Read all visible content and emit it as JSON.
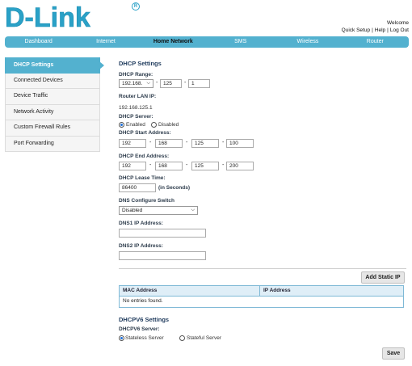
{
  "brand": {
    "logo_text": "D-Link",
    "reg_mark": "R"
  },
  "header": {
    "welcome": "Welcome",
    "links": [
      "Quick Setup",
      "Help",
      "Log Out"
    ],
    "separator": "|"
  },
  "nav": {
    "items": [
      "Dashboard",
      "Internet",
      "Home Network",
      "SMS",
      "Wireless",
      "Router"
    ],
    "active": "Home Network"
  },
  "sidebar": {
    "items": [
      "DHCP Settings",
      "Connected Devices",
      "Device Traffic",
      "Network Activity",
      "Custom Firewall Rules",
      "Port Forwarding"
    ],
    "active": "DHCP Settings"
  },
  "dhcp": {
    "title": "DHCP Settings",
    "range_label": "DHCP Range:",
    "range_prefix": "192.168.",
    "range_third": "125",
    "range_fourth": "1",
    "dash": "-",
    "router_lan_label": "Router LAN IP:",
    "router_lan_value": "192.168.125.1",
    "server_label": "DHCP Server:",
    "server_options": [
      "Enabled",
      "Disabled"
    ],
    "server_selected": "Enabled",
    "start_label": "DHCP Start Address:",
    "start": [
      "192",
      "168",
      "125",
      "100"
    ],
    "end_label": "DHCP End Address:",
    "end": [
      "192",
      "168",
      "125",
      "200"
    ],
    "lease_label": "DHCP Lease Time:",
    "lease_value": "86400",
    "lease_unit": "(in Seconds)",
    "dns_switch_label": "DNS Configure Switch",
    "dns_switch_value": "Disabled",
    "dns1_label": "DNS1 IP Address:",
    "dns1_value": "",
    "dns2_label": "DNS2 IP Address:",
    "dns2_value": ""
  },
  "static_ip": {
    "add_button": "Add Static IP",
    "columns": [
      "MAC Address",
      "IP Address"
    ],
    "empty_text": "No entries found."
  },
  "dhcpv6": {
    "title": "DHCPV6 Settings",
    "server_label": "DHCPV6 Server:",
    "options": [
      "Stateless Server",
      "Stateful Server"
    ],
    "selected": "Stateless Server"
  },
  "save_button": "Save",
  "colors": {
    "accent": "#53b1cf",
    "brand": "#2aa1c7",
    "table_border": "#7fb9d6"
  },
  "icons": {
    "dropdown": "chevron-down-icon",
    "active_pointer": "arrow-right-icon"
  }
}
